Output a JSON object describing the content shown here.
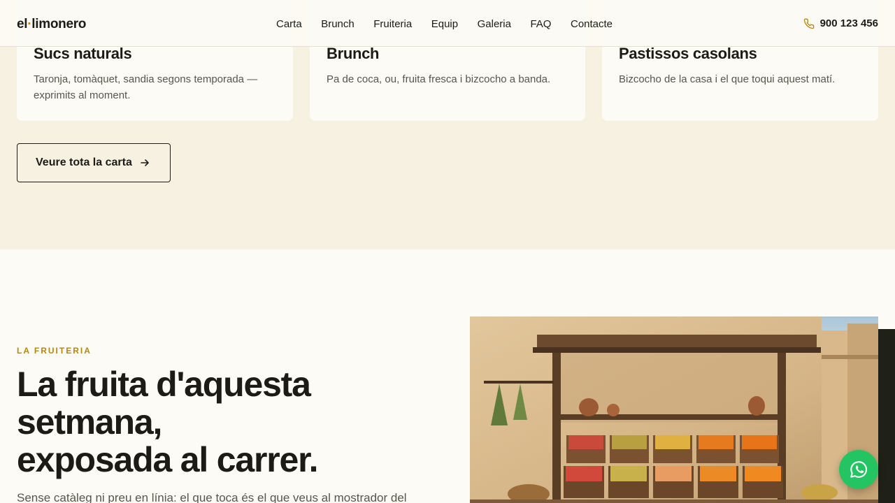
{
  "brand": {
    "logo_pre": "el",
    "logo_dot": "·",
    "logo_post": "limonero"
  },
  "nav": {
    "items": [
      "Carta",
      "Brunch",
      "Fruiteria",
      "Equip",
      "Galeria",
      "FAQ",
      "Contacte"
    ],
    "phone": "900 123 456"
  },
  "cards": [
    {
      "title": "Sucs naturals",
      "text": "Taronja, tomàquet, sandia segons temporada — exprimits al moment."
    },
    {
      "title": "Brunch",
      "text": "Pa de coca, ou, fruita fresca i bizcocho a banda."
    },
    {
      "title": "Pastissos casolans",
      "text": "Bizcocho de la casa i el que toqui aquest matí."
    }
  ],
  "cta_label": "Veure tota la carta",
  "fruiteria": {
    "eyebrow": "LA FRUITERIA",
    "headline_l1": "La fruita d'aquesta",
    "headline_l2": "setmana,",
    "headline_l3": "exposada al carrer.",
    "lead": "Sense catàleg ni preu en línia: el que toca és el que veus al mostrador del"
  },
  "colors": {
    "accent": "#b8860b",
    "whatsapp": "#25c462",
    "band": "#f7f1e1"
  },
  "icons": {
    "phone": "phone-icon",
    "arrow": "arrow-right-icon",
    "whatsapp": "whatsapp-icon"
  }
}
